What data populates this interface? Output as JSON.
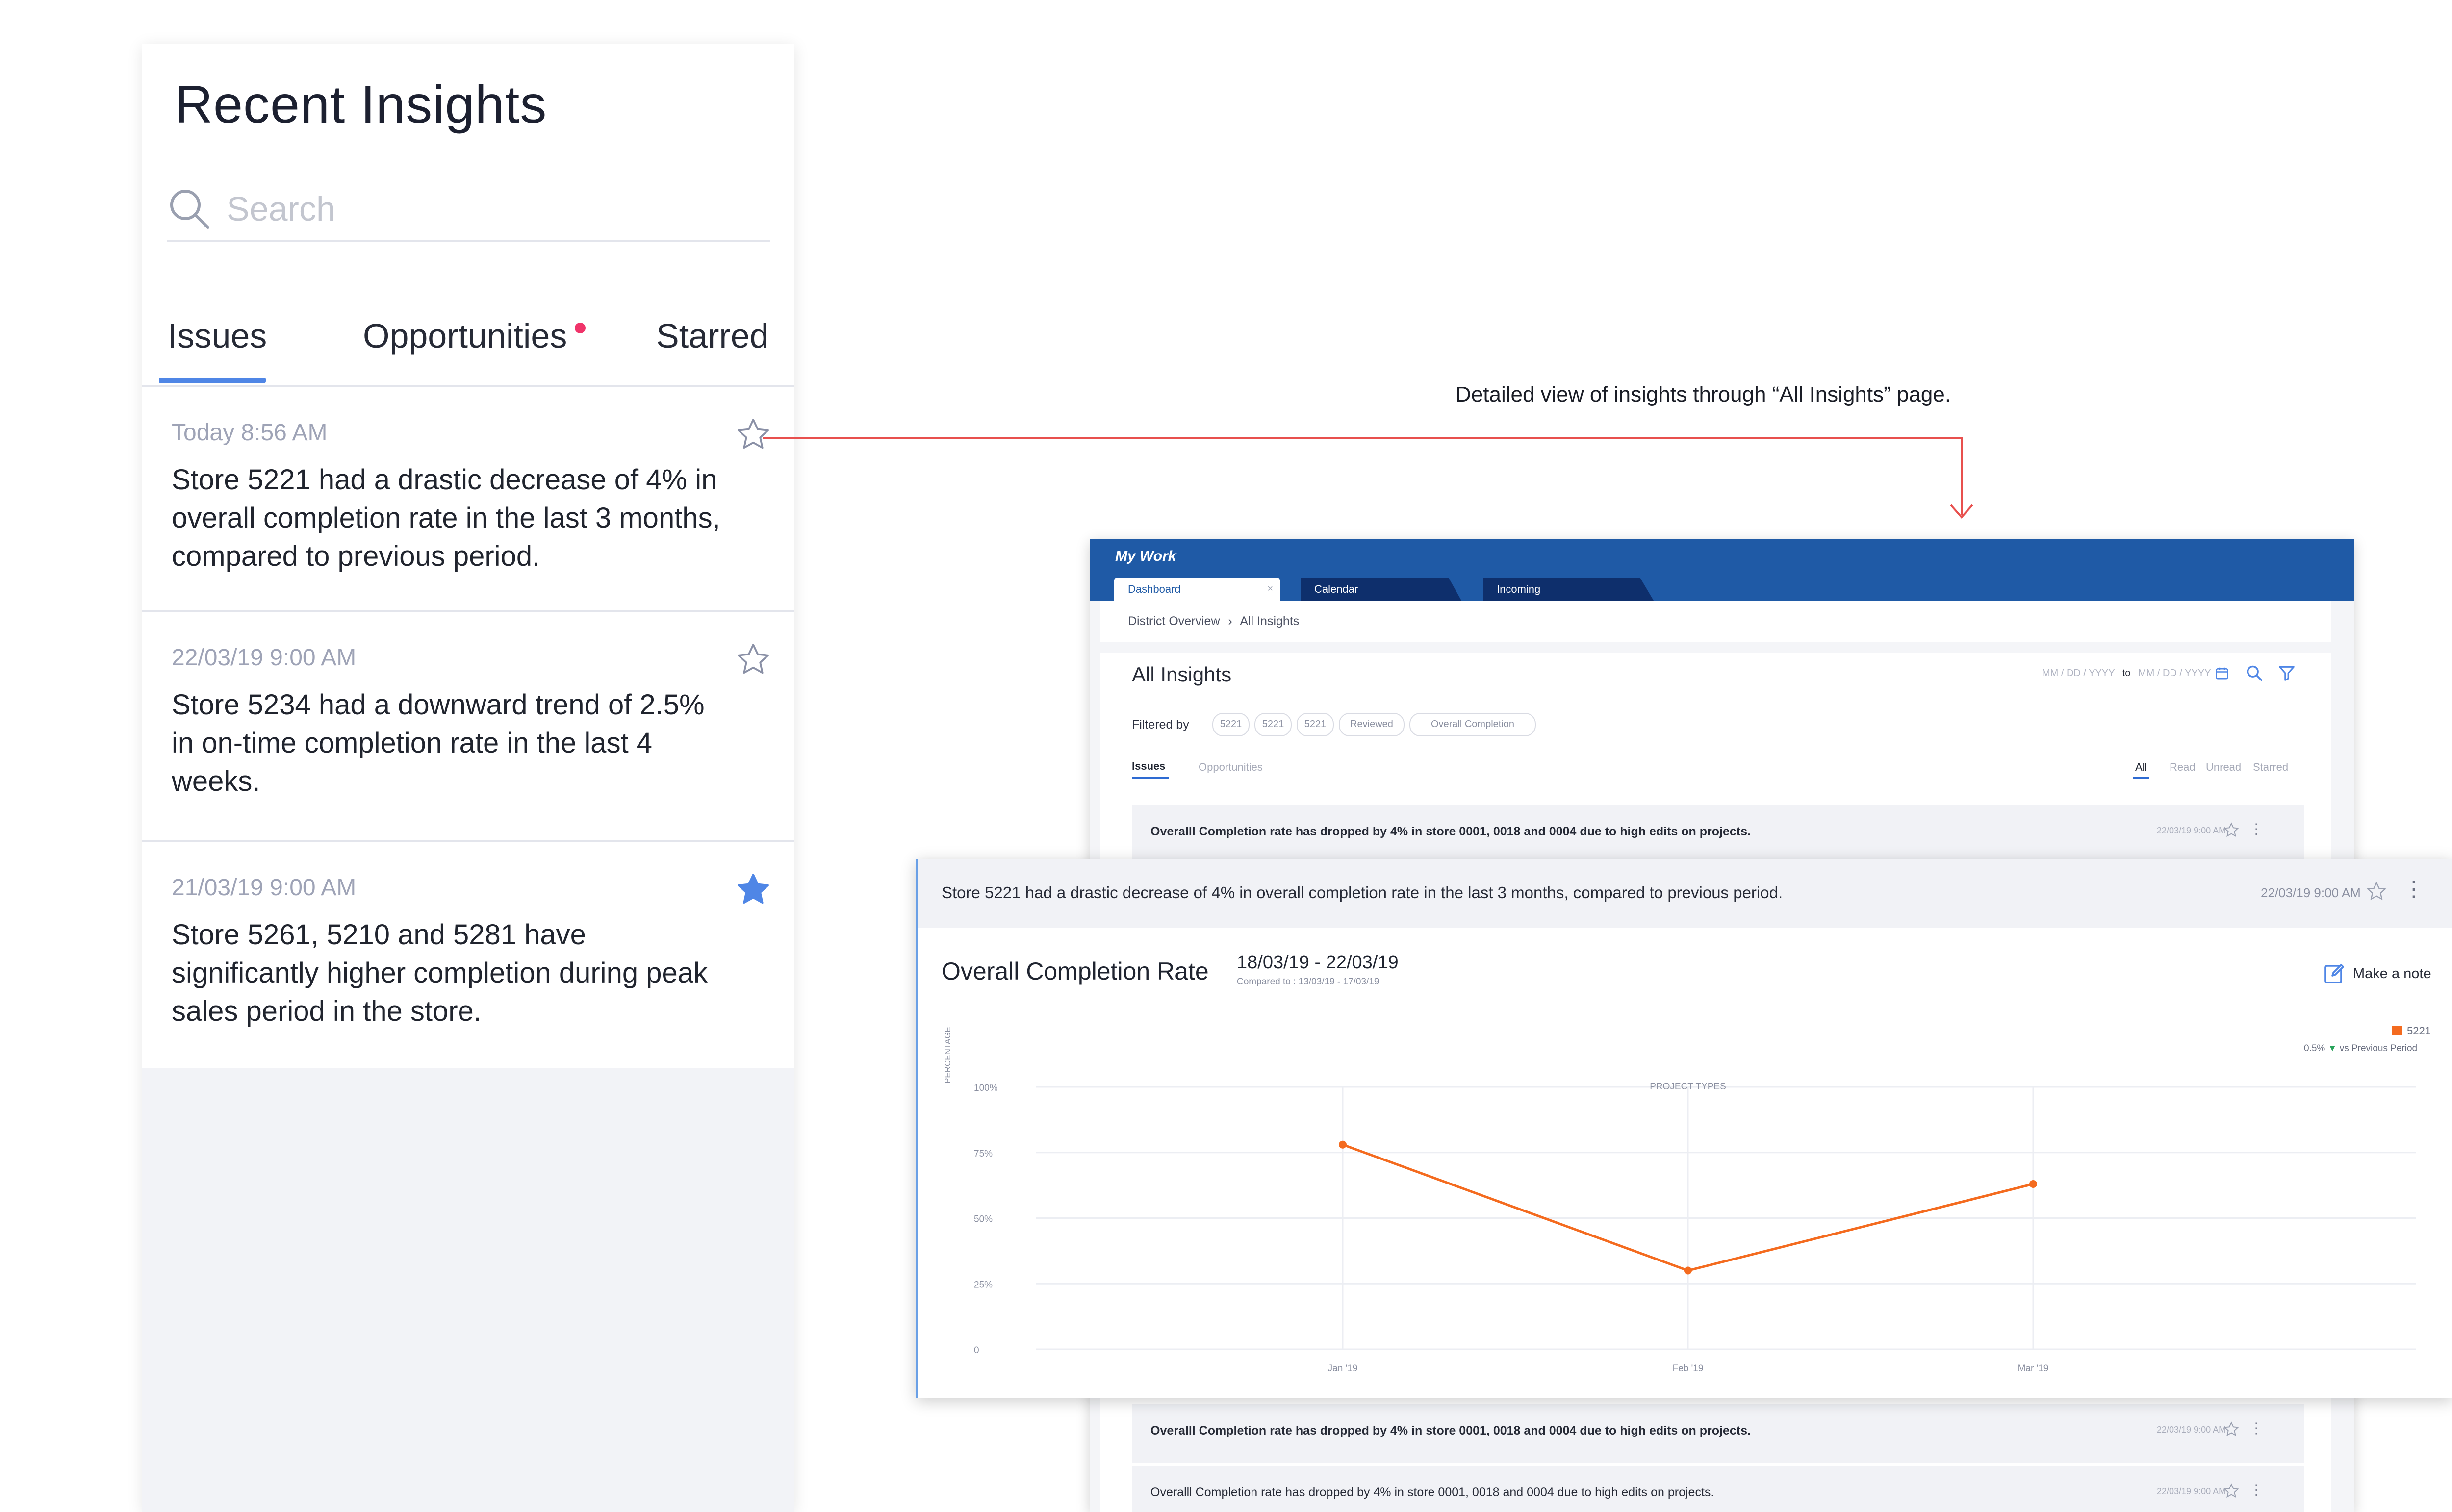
{
  "recent_insights": {
    "title": "Recent Insights",
    "search": {
      "placeholder": "Search"
    },
    "tabs": [
      {
        "label": "Issues",
        "active": true
      },
      {
        "label": "Opportunities",
        "has_notification": true
      },
      {
        "label": "Starred"
      }
    ],
    "items": [
      {
        "time": "Today 8:56 AM",
        "message": "Store 5221 had a drastic decrease of 4% in overall completion rate in the last 3 months, compared to previous period.",
        "starred": false
      },
      {
        "time": "22/03/19  9:00 AM",
        "message": "Store 5234 had a downward trend of 2.5% in on-time completion rate in the last 4 weeks.",
        "starred": false
      },
      {
        "time": "21/03/19  9:00 AM",
        "message": "Store 5261, 5210 and 5281 have significantly higher completion during peak sales period in the store.",
        "starred": true
      }
    ],
    "colors": {
      "accent": "#4f86e6",
      "notification": "#f0346a"
    }
  },
  "annotation": {
    "text": "Detailed view of insights through “All Insights” page.",
    "line_color": "#e8504e"
  },
  "all_insights_window": {
    "app_title": "My Work",
    "tabs": [
      "Dashboard",
      "Calendar",
      "Incoming"
    ],
    "tab_close": "×",
    "breadcrumb": [
      "District Overview",
      "All Insights"
    ],
    "breadcrumb_separator": "›",
    "heading": "All Insights",
    "date_from_placeholder": "MM / DD / YYYY",
    "date_to_label": "to",
    "date_to_placeholder": "MM / DD / YYYY",
    "filtered_by_label": "Filtered by",
    "filter_chips": [
      "5221",
      "5221",
      "5221",
      "Reviewed",
      "Overall Completion"
    ],
    "subtabs": [
      "Issues",
      "Opportunities"
    ],
    "status_filters": [
      "All",
      "Read",
      "Unread",
      "Starred"
    ],
    "rows": [
      {
        "text": "Overalll Completion rate has dropped by 4% in store 0001, 0018 and 0004 due to high edits on projects.",
        "date": "22/03/19  9:00 AM",
        "bold": true
      },
      {
        "text": "Overalll Completion rate has dropped by 4% in store 0001, 0018 and 0004 due to high edits on projects.",
        "date": "22/03/19  9:00 AM",
        "bold": true
      },
      {
        "text": "Overalll Completion rate has dropped by 4% in store 0001, 0018 and 0004 due to high edits on projects.",
        "date": "22/03/19  9:00 AM",
        "bold": false
      }
    ],
    "header_color": "#1f5aa6"
  },
  "expanded_insight": {
    "text": "Store 5221 had a drastic decrease of 4% in overall completion rate in the last 3 months, compared to previous period.",
    "date": "22/03/19  9:00 AM",
    "chart_title": "Overall Completion Rate",
    "date_range": "18/03/19 - 22/03/19",
    "compared_to": "Compared to : 13/03/19 - 17/03/19",
    "make_note": "Make a note",
    "legend_delta": "0.5%",
    "legend_delta_arrow": "▼",
    "legend_delta_suffix": "vs Previous Period"
  },
  "chart_data": {
    "type": "line",
    "title": "Overall Completion Rate",
    "x": [
      "Jan '19",
      "Feb '19",
      "Mar '19"
    ],
    "series": [
      {
        "name": "5221",
        "values": [
          78,
          30,
          63
        ],
        "color": "#f46b1f"
      }
    ],
    "ylabel": "PERCENTAGE",
    "xlabel": "PROJECT TYPES",
    "y_ticks": [
      "100%",
      "75%",
      "50%",
      "25%",
      "0"
    ],
    "ylim": [
      0,
      100
    ],
    "grid": true,
    "legend_position": "top-right"
  }
}
